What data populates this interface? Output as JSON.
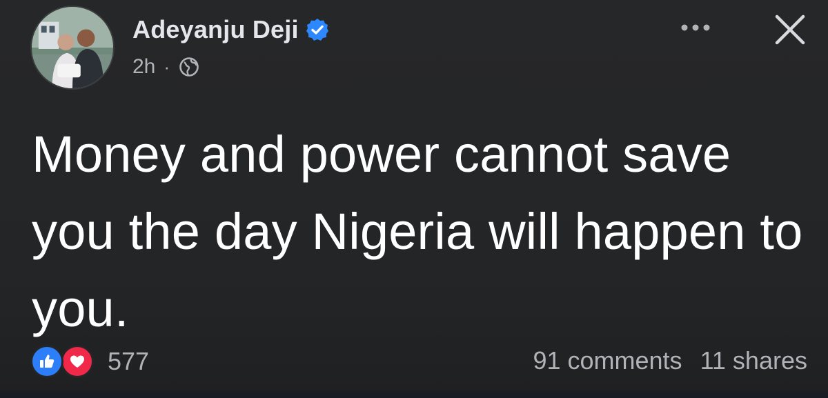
{
  "post": {
    "author": {
      "name": "Adeyanju Deji",
      "verified": true
    },
    "time": "2h",
    "separator": "·",
    "audience_icon": "globe-icon",
    "text": "Money and power cannot save you the day Nigeria will happen to you.",
    "reactions": {
      "types": [
        "like",
        "love"
      ],
      "count": "577"
    },
    "comments": "91 comments",
    "shares": "11 shares"
  },
  "icons": {
    "more": "more-horizontal-icon",
    "close": "close-icon",
    "verified": "verified-badge-icon"
  },
  "colors": {
    "background": "#242526",
    "primary_text": "#ffffff",
    "secondary_text": "#b0b3b8",
    "like_blue": "#2d7ff9",
    "love_red": "#f0284a",
    "verified_blue": "#2d88ff"
  }
}
